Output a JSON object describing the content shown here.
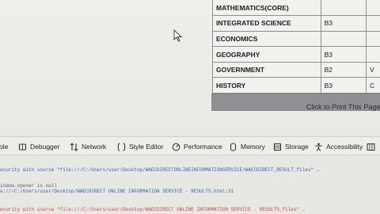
{
  "results_table": {
    "rows": [
      {
        "subject": "MATHEMATICS(CORE)",
        "grade": "",
        "extra": ""
      },
      {
        "subject": "INTEGRATED SCIENCE",
        "grade": "B3",
        "extra": ""
      },
      {
        "subject": "ECONOMICS",
        "grade": "",
        "extra": ""
      },
      {
        "subject": "GEOGRAPHY",
        "grade": "B3",
        "extra": ""
      },
      {
        "subject": "GOVERNMENT",
        "grade": "B2",
        "extra": "V"
      },
      {
        "subject": "HISTORY",
        "grade": "B3",
        "extra": "C"
      }
    ]
  },
  "check_bar": {
    "label": "Click to Print This Page"
  },
  "devtools": {
    "tabs": [
      {
        "label": "ole",
        "icon": "console-icon"
      },
      {
        "label": "Debugger",
        "icon": "debugger-icon"
      },
      {
        "label": "Network",
        "icon": "network-icon"
      },
      {
        "label": "Style Editor",
        "icon": "style-editor-icon"
      },
      {
        "label": "Performance",
        "icon": "performance-icon"
      },
      {
        "label": "Memory",
        "icon": "memory-icon"
      },
      {
        "label": "Storage",
        "icon": "storage-icon"
      },
      {
        "label": "Accessibility",
        "icon": "accessibility-icon"
      }
    ],
    "console_lines": [
      {
        "text": "ecurity with source \"file:///C:/Users/user/Desktop/WAECDIRECTONLINEINFORMATIONSERVICE/WAECDIRECT_RESULT_files\" …",
        "kind": "url"
      },
      {
        "text": "indow.opener is null",
        "kind": "plain"
      },
      {
        "text": "e:///C:/Users/user/Desktop/WAECDIRECT ONLINE INFORMATION SERVICE - RESULTS.html:31",
        "kind": "url"
      },
      {
        "text": "ecurity with source \"file:///C:/Users/user/Desktop/WAECDIRECT ONLINE INFORMATION SERVICE - RESULTS_files\" …",
        "kind": "err"
      }
    ]
  }
}
